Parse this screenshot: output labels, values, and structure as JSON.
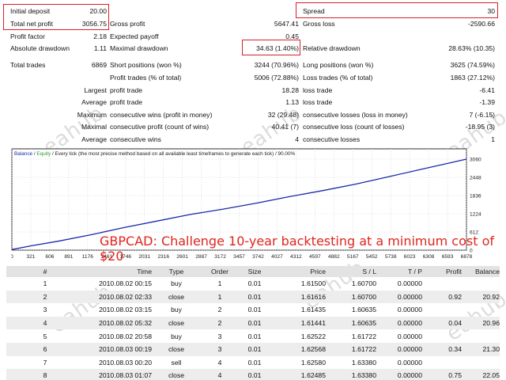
{
  "stats_left": [
    {
      "label": "Initial deposit",
      "value": "20.00"
    },
    {
      "label": "Total net profit",
      "value": "3056.75"
    },
    {
      "label": "Profit factor",
      "value": "2.18"
    },
    {
      "label": "Absolute drawdown",
      "value": "1.11"
    },
    {
      "label": "Total trades",
      "value": "6869"
    }
  ],
  "stats_mid": [
    {
      "label": "Gross profit",
      "value": "5647.41"
    },
    {
      "label": "Expected payoff",
      "value": "0.45"
    },
    {
      "label": "Maximal drawdown",
      "value": "34.63 (1.40%)"
    },
    {
      "label": "Short positions (won %)",
      "value": "3244 (70.96%)"
    },
    {
      "label": "Profit trades (% of total)",
      "value": "5006 (72.88%)"
    },
    {
      "label": "profit trade",
      "value": "18.28",
      "prefix": "Largest"
    },
    {
      "label": "profit trade",
      "value": "1.13",
      "prefix": "Average"
    },
    {
      "label": "consecutive wins (profit in money)",
      "value": "32 (29.48)",
      "prefix": "Maximum"
    },
    {
      "label": "consecutive profit (count of wins)",
      "value": "40.41 (7)",
      "prefix": "Maximal"
    },
    {
      "label": "consecutive wins",
      "value": "4",
      "prefix": "Average"
    }
  ],
  "stats_right": [
    {
      "label": "Spread",
      "value": "30"
    },
    {
      "label": "Gross loss",
      "value": "-2590.66"
    },
    {
      "label": "Relative drawdown",
      "value": "28.63% (10.35)"
    },
    {
      "label": "Long positions (won %)",
      "value": "3625 (74.59%)"
    },
    {
      "label": "Loss trades (% of total)",
      "value": "1863 (27.12%)"
    },
    {
      "label": "loss trade",
      "value": "-6.41"
    },
    {
      "label": "loss trade",
      "value": "-1.39"
    },
    {
      "label": "consecutive losses (loss in money)",
      "value": "7 (-6.15)"
    },
    {
      "label": "consecutive loss (count of losses)",
      "value": "-18.95 (3)"
    },
    {
      "label": "consecutive losses",
      "value": "1"
    }
  ],
  "chart_data": {
    "type": "line",
    "title": "",
    "legend_balance": "Balance",
    "legend_equity": "Equity",
    "legend_note": "/ Every tick (the most precise method based on all available least timeframes to generate each tick) / 90.00%",
    "overlay_caption": "GBPCAD: Challenge 10-year backtesting at a minimum cost of $20",
    "x_ticks": [
      "0",
      "321",
      "606",
      "891",
      "1176",
      "1461",
      "1746",
      "2031",
      "2316",
      "2601",
      "2887",
      "3172",
      "3457",
      "3742",
      "4027",
      "4312",
      "4597",
      "4882",
      "5167",
      "5452",
      "5738",
      "6023",
      "6308",
      "6593",
      "6878"
    ],
    "y_ticks": [
      "3060",
      "2448",
      "1836",
      "1224",
      "612",
      "0"
    ],
    "xlim": [
      0,
      6878
    ],
    "ylim": [
      0,
      3060
    ],
    "series": [
      {
        "name": "Balance",
        "x": [
          0,
          300,
          700,
          1200,
          1700,
          2200,
          2700,
          3200,
          3700,
          4200,
          4700,
          5200,
          5700,
          6200,
          6600,
          6878
        ],
        "values": [
          20,
          150,
          300,
          520,
          760,
          980,
          1200,
          1380,
          1580,
          1800,
          2000,
          2220,
          2470,
          2720,
          2920,
          3060
        ]
      }
    ],
    "colors": {
      "line": "#1a2aa8",
      "grid": "#c8c8c8"
    }
  },
  "trades": {
    "headers": [
      "#",
      "Time",
      "Type",
      "Order",
      "Size",
      "Price",
      "S / L",
      "T / P",
      "Profit",
      "Balance"
    ],
    "rows": [
      [
        "1",
        "2010.08.02 00:15",
        "buy",
        "1",
        "0.01",
        "1.61500",
        "1.60700",
        "0.00000",
        "",
        ""
      ],
      [
        "2",
        "2010.08.02 02:33",
        "close",
        "1",
        "0.01",
        "1.61616",
        "1.60700",
        "0.00000",
        "0.92",
        "20.92"
      ],
      [
        "3",
        "2010.08.02 03:15",
        "buy",
        "2",
        "0.01",
        "1.61435",
        "1.60635",
        "0.00000",
        "",
        ""
      ],
      [
        "4",
        "2010.08.02 05:32",
        "close",
        "2",
        "0.01",
        "1.61441",
        "1.60635",
        "0.00000",
        "0.04",
        "20.96"
      ],
      [
        "5",
        "2010.08.02 20:58",
        "buy",
        "3",
        "0.01",
        "1.62522",
        "1.61722",
        "0.00000",
        "",
        ""
      ],
      [
        "6",
        "2010.08.03 00:19",
        "close",
        "3",
        "0.01",
        "1.62568",
        "1.61722",
        "0.00000",
        "0.34",
        "21.30"
      ],
      [
        "7",
        "2010.08.03 00:20",
        "sell",
        "4",
        "0.01",
        "1.62580",
        "1.63380",
        "0.00000",
        "",
        ""
      ],
      [
        "8",
        "2010.08.03 01:07",
        "close",
        "4",
        "0.01",
        "1.62485",
        "1.63380",
        "0.00000",
        "0.75",
        "22.05"
      ]
    ]
  }
}
